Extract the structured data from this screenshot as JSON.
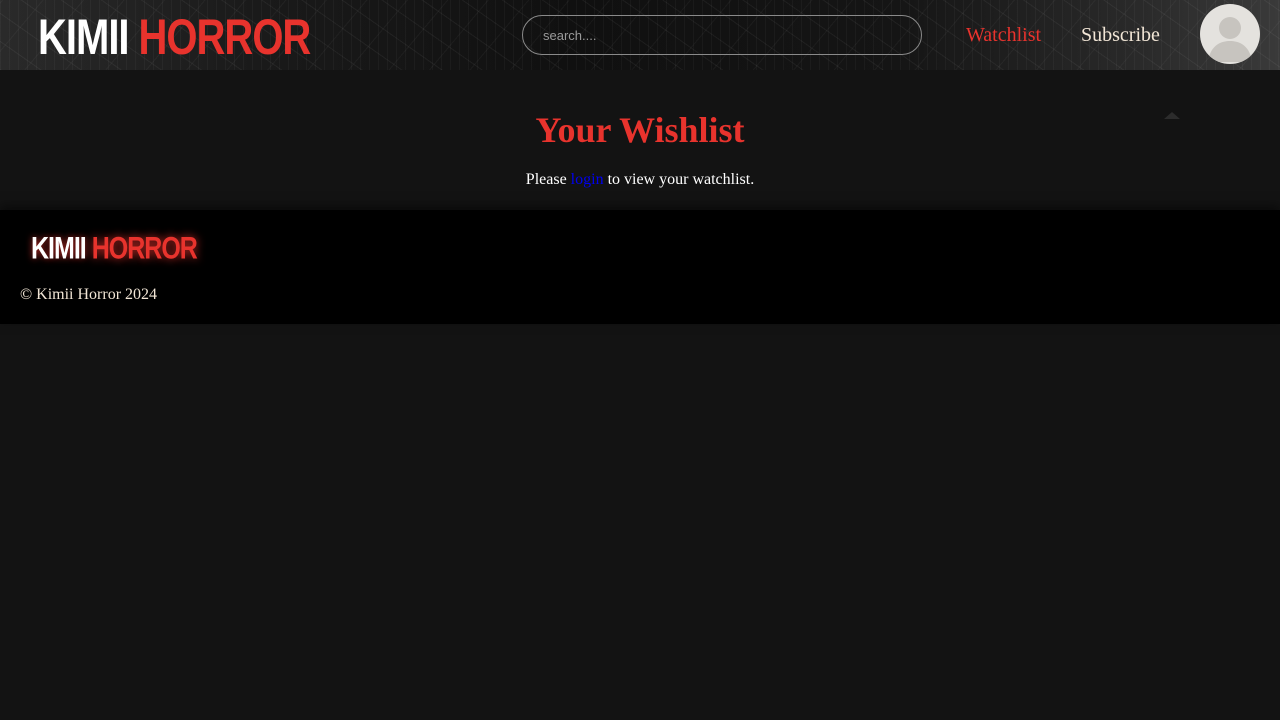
{
  "header": {
    "logo": {
      "part1": "KIMII",
      "part2": "HORROR"
    },
    "search": {
      "placeholder": "search...."
    },
    "nav": {
      "watchlist": "Watchlist",
      "subscribe": "Subscribe"
    }
  },
  "main": {
    "title": "Your Wishlist",
    "message": {
      "before": "Please ",
      "link": "login",
      "after": " to view your watchlist."
    }
  },
  "footer": {
    "logo": {
      "part1": "KIMII",
      "part2": "HORROR"
    },
    "copyright": "© Kimii Horror 2024"
  },
  "colors": {
    "accent": "#e8332d",
    "background": "#131313",
    "footer_bg": "#000000",
    "link": "#0000ee"
  }
}
